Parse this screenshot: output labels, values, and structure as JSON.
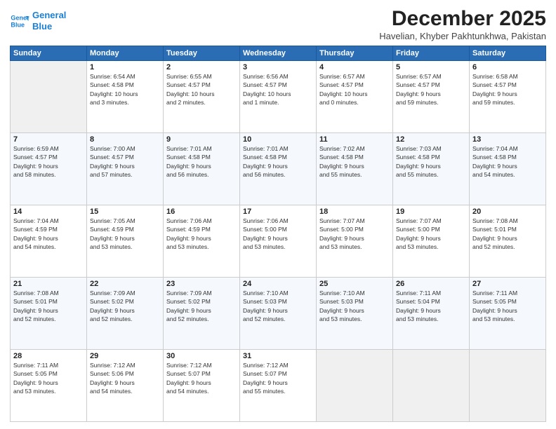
{
  "logo": {
    "line1": "General",
    "line2": "Blue"
  },
  "header": {
    "month": "December 2025",
    "location": "Havelian, Khyber Pakhtunkhwa, Pakistan"
  },
  "weekdays": [
    "Sunday",
    "Monday",
    "Tuesday",
    "Wednesday",
    "Thursday",
    "Friday",
    "Saturday"
  ],
  "weeks": [
    [
      {
        "day": "",
        "info": ""
      },
      {
        "day": "1",
        "info": "Sunrise: 6:54 AM\nSunset: 4:58 PM\nDaylight: 10 hours\nand 3 minutes."
      },
      {
        "day": "2",
        "info": "Sunrise: 6:55 AM\nSunset: 4:57 PM\nDaylight: 10 hours\nand 2 minutes."
      },
      {
        "day": "3",
        "info": "Sunrise: 6:56 AM\nSunset: 4:57 PM\nDaylight: 10 hours\nand 1 minute."
      },
      {
        "day": "4",
        "info": "Sunrise: 6:57 AM\nSunset: 4:57 PM\nDaylight: 10 hours\nand 0 minutes."
      },
      {
        "day": "5",
        "info": "Sunrise: 6:57 AM\nSunset: 4:57 PM\nDaylight: 9 hours\nand 59 minutes."
      },
      {
        "day": "6",
        "info": "Sunrise: 6:58 AM\nSunset: 4:57 PM\nDaylight: 9 hours\nand 59 minutes."
      }
    ],
    [
      {
        "day": "7",
        "info": "Sunrise: 6:59 AM\nSunset: 4:57 PM\nDaylight: 9 hours\nand 58 minutes."
      },
      {
        "day": "8",
        "info": "Sunrise: 7:00 AM\nSunset: 4:57 PM\nDaylight: 9 hours\nand 57 minutes."
      },
      {
        "day": "9",
        "info": "Sunrise: 7:01 AM\nSunset: 4:58 PM\nDaylight: 9 hours\nand 56 minutes."
      },
      {
        "day": "10",
        "info": "Sunrise: 7:01 AM\nSunset: 4:58 PM\nDaylight: 9 hours\nand 56 minutes."
      },
      {
        "day": "11",
        "info": "Sunrise: 7:02 AM\nSunset: 4:58 PM\nDaylight: 9 hours\nand 55 minutes."
      },
      {
        "day": "12",
        "info": "Sunrise: 7:03 AM\nSunset: 4:58 PM\nDaylight: 9 hours\nand 55 minutes."
      },
      {
        "day": "13",
        "info": "Sunrise: 7:04 AM\nSunset: 4:58 PM\nDaylight: 9 hours\nand 54 minutes."
      }
    ],
    [
      {
        "day": "14",
        "info": "Sunrise: 7:04 AM\nSunset: 4:59 PM\nDaylight: 9 hours\nand 54 minutes."
      },
      {
        "day": "15",
        "info": "Sunrise: 7:05 AM\nSunset: 4:59 PM\nDaylight: 9 hours\nand 53 minutes."
      },
      {
        "day": "16",
        "info": "Sunrise: 7:06 AM\nSunset: 4:59 PM\nDaylight: 9 hours\nand 53 minutes."
      },
      {
        "day": "17",
        "info": "Sunrise: 7:06 AM\nSunset: 5:00 PM\nDaylight: 9 hours\nand 53 minutes."
      },
      {
        "day": "18",
        "info": "Sunrise: 7:07 AM\nSunset: 5:00 PM\nDaylight: 9 hours\nand 53 minutes."
      },
      {
        "day": "19",
        "info": "Sunrise: 7:07 AM\nSunset: 5:00 PM\nDaylight: 9 hours\nand 53 minutes."
      },
      {
        "day": "20",
        "info": "Sunrise: 7:08 AM\nSunset: 5:01 PM\nDaylight: 9 hours\nand 52 minutes."
      }
    ],
    [
      {
        "day": "21",
        "info": "Sunrise: 7:08 AM\nSunset: 5:01 PM\nDaylight: 9 hours\nand 52 minutes."
      },
      {
        "day": "22",
        "info": "Sunrise: 7:09 AM\nSunset: 5:02 PM\nDaylight: 9 hours\nand 52 minutes."
      },
      {
        "day": "23",
        "info": "Sunrise: 7:09 AM\nSunset: 5:02 PM\nDaylight: 9 hours\nand 52 minutes."
      },
      {
        "day": "24",
        "info": "Sunrise: 7:10 AM\nSunset: 5:03 PM\nDaylight: 9 hours\nand 52 minutes."
      },
      {
        "day": "25",
        "info": "Sunrise: 7:10 AM\nSunset: 5:03 PM\nDaylight: 9 hours\nand 53 minutes."
      },
      {
        "day": "26",
        "info": "Sunrise: 7:11 AM\nSunset: 5:04 PM\nDaylight: 9 hours\nand 53 minutes."
      },
      {
        "day": "27",
        "info": "Sunrise: 7:11 AM\nSunset: 5:05 PM\nDaylight: 9 hours\nand 53 minutes."
      }
    ],
    [
      {
        "day": "28",
        "info": "Sunrise: 7:11 AM\nSunset: 5:05 PM\nDaylight: 9 hours\nand 53 minutes."
      },
      {
        "day": "29",
        "info": "Sunrise: 7:12 AM\nSunset: 5:06 PM\nDaylight: 9 hours\nand 54 minutes."
      },
      {
        "day": "30",
        "info": "Sunrise: 7:12 AM\nSunset: 5:07 PM\nDaylight: 9 hours\nand 54 minutes."
      },
      {
        "day": "31",
        "info": "Sunrise: 7:12 AM\nSunset: 5:07 PM\nDaylight: 9 hours\nand 55 minutes."
      },
      {
        "day": "",
        "info": ""
      },
      {
        "day": "",
        "info": ""
      },
      {
        "day": "",
        "info": ""
      }
    ]
  ]
}
